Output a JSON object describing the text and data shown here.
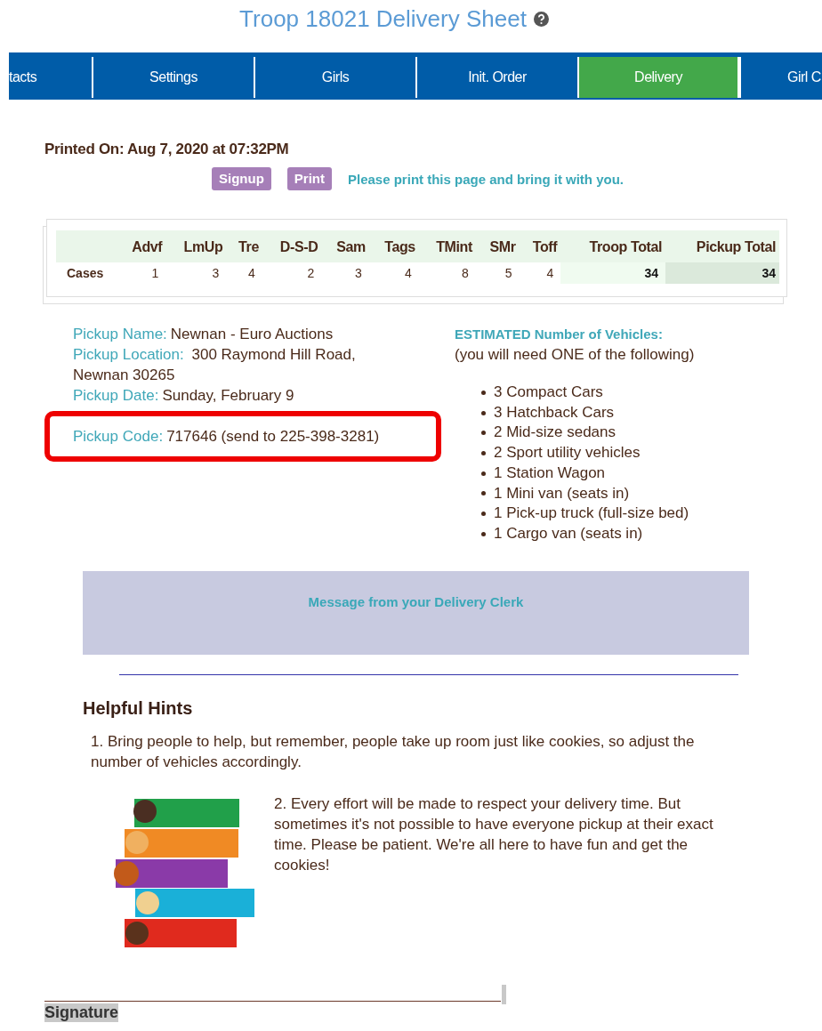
{
  "header": {
    "title": "Troop 18021 Delivery Sheet"
  },
  "tabs": [
    {
      "label": "tacts",
      "selected": false
    },
    {
      "label": "Settings",
      "selected": false
    },
    {
      "label": "Girls",
      "selected": false
    },
    {
      "label": "Init. Order",
      "selected": false
    },
    {
      "label": "Delivery",
      "selected": true
    },
    {
      "label": "Girl C",
      "selected": false
    }
  ],
  "printed_on": "Printed On: Aug 7, 2020 at 07:32PM",
  "actions": {
    "buttons": [
      "Signup",
      "Print"
    ],
    "note": "Please print this page and bring it with you."
  },
  "table": {
    "columns": [
      {
        "label": "Advf",
        "kind": "item"
      },
      {
        "label": "LmUp",
        "kind": "item"
      },
      {
        "label": "Tre",
        "kind": "item"
      },
      {
        "label": "D-S-D",
        "kind": "item"
      },
      {
        "label": "Sam",
        "kind": "item"
      },
      {
        "label": "Tags",
        "kind": "item"
      },
      {
        "label": "TMint",
        "kind": "item"
      },
      {
        "label": "SMr",
        "kind": "item"
      },
      {
        "label": "Toff",
        "kind": "item"
      },
      {
        "label": "Troop Total",
        "kind": "troop_total"
      },
      {
        "label": "Pickup Total",
        "kind": "pickup_total"
      }
    ],
    "rows": [
      {
        "label": "Cases",
        "cells": [
          "1",
          "3",
          "4",
          "2",
          "3",
          "4",
          "8",
          "5",
          "4",
          "34",
          "34"
        ]
      }
    ]
  },
  "pickup_details": [
    {
      "label": "Pickup Name:",
      "value": "Newnan - Euro Auctions",
      "highlighted": false
    },
    {
      "label": "Pickup Location:",
      "value": " 300 Raymond Hill Road,",
      "value_line_2": "Newnan 30265",
      "highlighted": false
    },
    {
      "label": "Pickup Date:",
      "value": "Sunday, February 9",
      "highlighted": false
    },
    {
      "label": "Pickup Code:",
      "value": "717646 (send to 225-398-3281)",
      "highlighted": true
    }
  ],
  "vehicles": {
    "title": "ESTIMATED Number of Vehicles:",
    "subtitle": "(you will need ONE of the following)",
    "items": [
      "3 Compact Cars",
      "3 Hatchback Cars",
      "2 Mid-size sedans",
      "2 Sport utility vehicles",
      "1 Station Wagon",
      "1 Mini van (seats in)",
      "1 Pick-up truck (full-size bed)",
      "1 Cargo van (seats in)"
    ]
  },
  "message": {
    "title": "Message from your Delivery Clerk"
  },
  "hints": {
    "title": "Helpful Hints",
    "items": [
      "1. Bring people to help, but remember, people take up room just like cookies, so adjust the number of vehicles accordingly.",
      "2. Every effort will be made to respect your delivery time. But sometimes it's not possible to have everyone pickup at their exact time. Please be patient. We're all here to have fun and get the cookies!"
    ]
  },
  "signature": {
    "label": "Signature"
  }
}
